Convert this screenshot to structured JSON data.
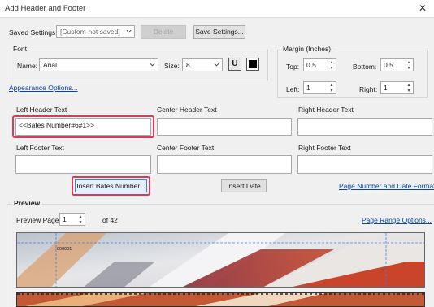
{
  "window": {
    "title": "Add Header and Footer",
    "close_glyph": "✕"
  },
  "saved_settings": {
    "label": "Saved Settings:",
    "value": "[Custom-not saved]",
    "delete_label": "Delete",
    "save_label": "Save Settings..."
  },
  "font": {
    "group_label": "Font",
    "name_label": "Name:",
    "name_value": "Arial",
    "size_label": "Size:",
    "size_value": "8",
    "underline_glyph": "U"
  },
  "margin": {
    "group_label": "Margin (Inches)",
    "top_label": "Top:",
    "top_value": "0.5",
    "bottom_label": "Bottom:",
    "bottom_value": "0.5",
    "left_label": "Left:",
    "left_value": "1",
    "right_label": "Right:",
    "right_value": "1"
  },
  "appearance_link": "Appearance Options...",
  "fields": {
    "left_header_label": "Left Header Text",
    "left_header_value": "<<Bates Number#6#1>>",
    "center_header_label": "Center Header Text",
    "right_header_label": "Right Header Text",
    "left_footer_label": "Left Footer Text",
    "center_footer_label": "Center Footer Text",
    "right_footer_label": "Right Footer Text"
  },
  "actions": {
    "insert_bates_label": "Insert Bates Number...",
    "insert_date_label": "Insert Date",
    "page_number_link": "Page Number and Date Format..."
  },
  "preview": {
    "group_label": "Preview",
    "page_label": "Preview Page",
    "page_value": "1",
    "page_total": "of 42",
    "range_link": "Page Range Options...",
    "bates_stamp": "000001"
  },
  "colors": {
    "highlight": "#d83a5a",
    "link": "#0645ad"
  }
}
